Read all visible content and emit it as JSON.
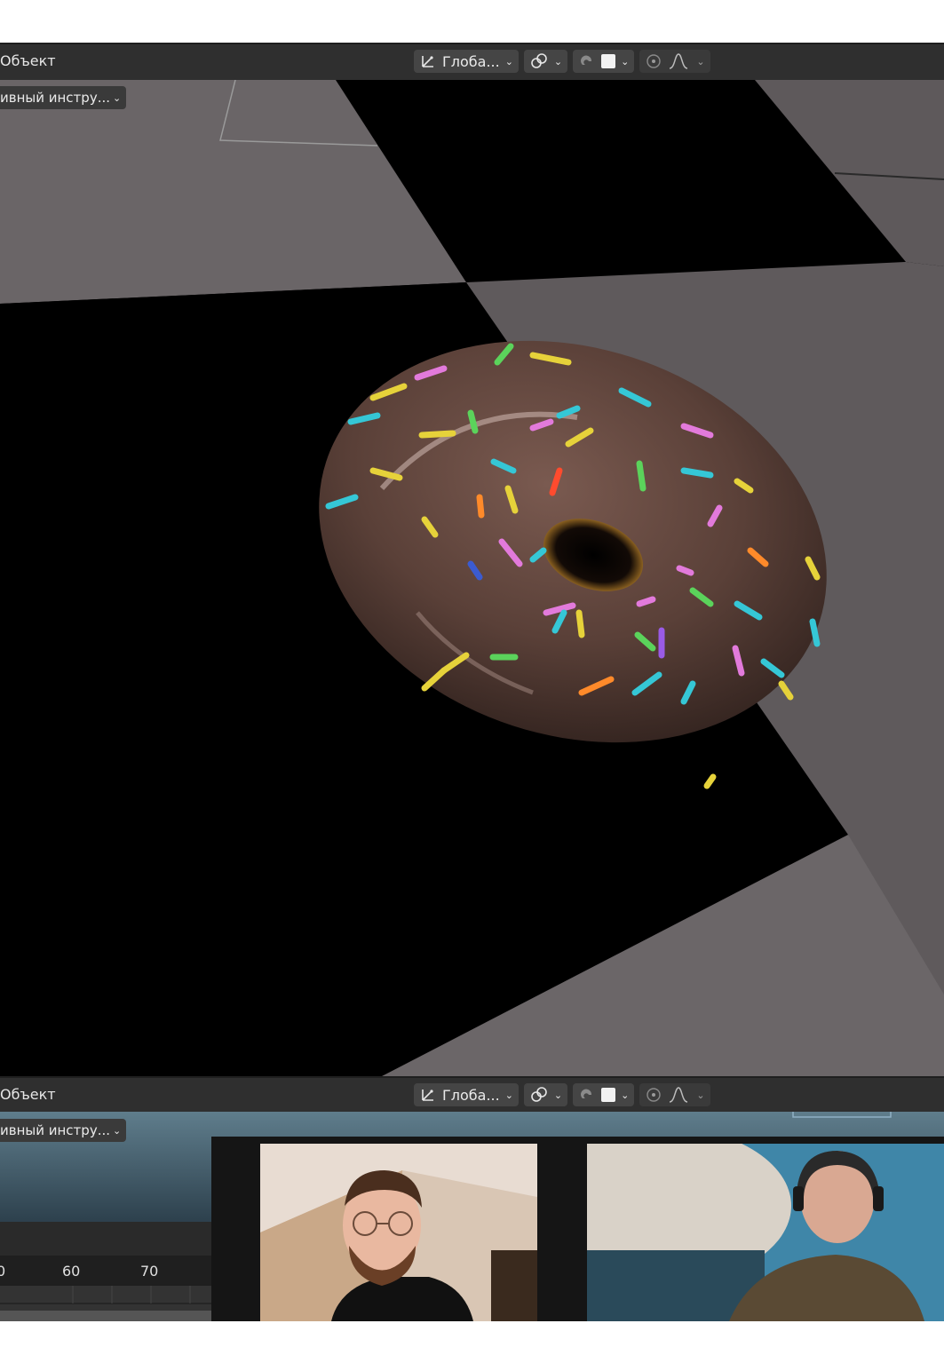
{
  "header_top": {
    "object_menu": "Объект",
    "transform_orientation": "Глоба...",
    "active_tool": "ивный инстру..."
  },
  "header_bottom": {
    "object_menu": "Объект",
    "transform_orientation": "Глоба...",
    "active_tool": "ивный инстру..."
  },
  "icons": [
    "transform-axes-icon",
    "link-snap-icon",
    "snap-magnet-icon",
    "color-swatch-icon",
    "proportional-edit-icon",
    "falloff-curve-icon"
  ],
  "colors": {
    "header_bg": "#2f2f2f",
    "donut_icing": "#5a4038",
    "floor_gray": "#6a6567"
  },
  "timeline": {
    "ticks": [
      "0",
      "60",
      "70"
    ]
  }
}
